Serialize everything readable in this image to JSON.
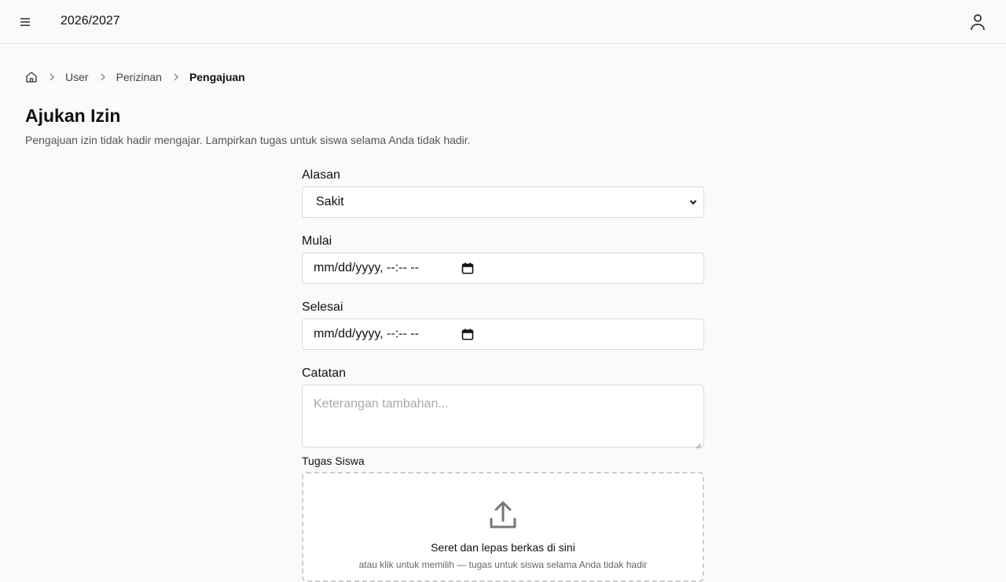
{
  "header": {
    "year": "2026/2027"
  },
  "breadcrumb": {
    "items": [
      "User",
      "Perizinan"
    ],
    "current": "Pengajuan"
  },
  "page": {
    "title": "Ajukan Izin",
    "description": "Pengajuan izin tidak hadir mengajar. Lampirkan tugas untuk siswa selama Anda tidak hadir."
  },
  "form": {
    "reason": {
      "label": "Alasan",
      "value": "Sakit"
    },
    "start": {
      "label": "Mulai",
      "placeholder": "mm/dd/yyyy, --:-- --"
    },
    "end": {
      "label": "Selesai",
      "placeholder": "mm/dd/yyyy, --:-- --"
    },
    "notes": {
      "label": "Catatan",
      "placeholder": "Keterangan tambahan..."
    },
    "assignment": {
      "label": "Tugas Siswa",
      "drop_title": "Seret dan lepas berkas di sini",
      "drop_sub": "atau klik untuk memilih — tugas untuk siswa selama Anda tidak hadir"
    }
  },
  "icons": {
    "menu": "menu-icon",
    "user": "user-icon",
    "home": "home-icon",
    "chevron": "chevron-right-icon",
    "calendar": "calendar-icon",
    "upload": "upload-icon"
  }
}
